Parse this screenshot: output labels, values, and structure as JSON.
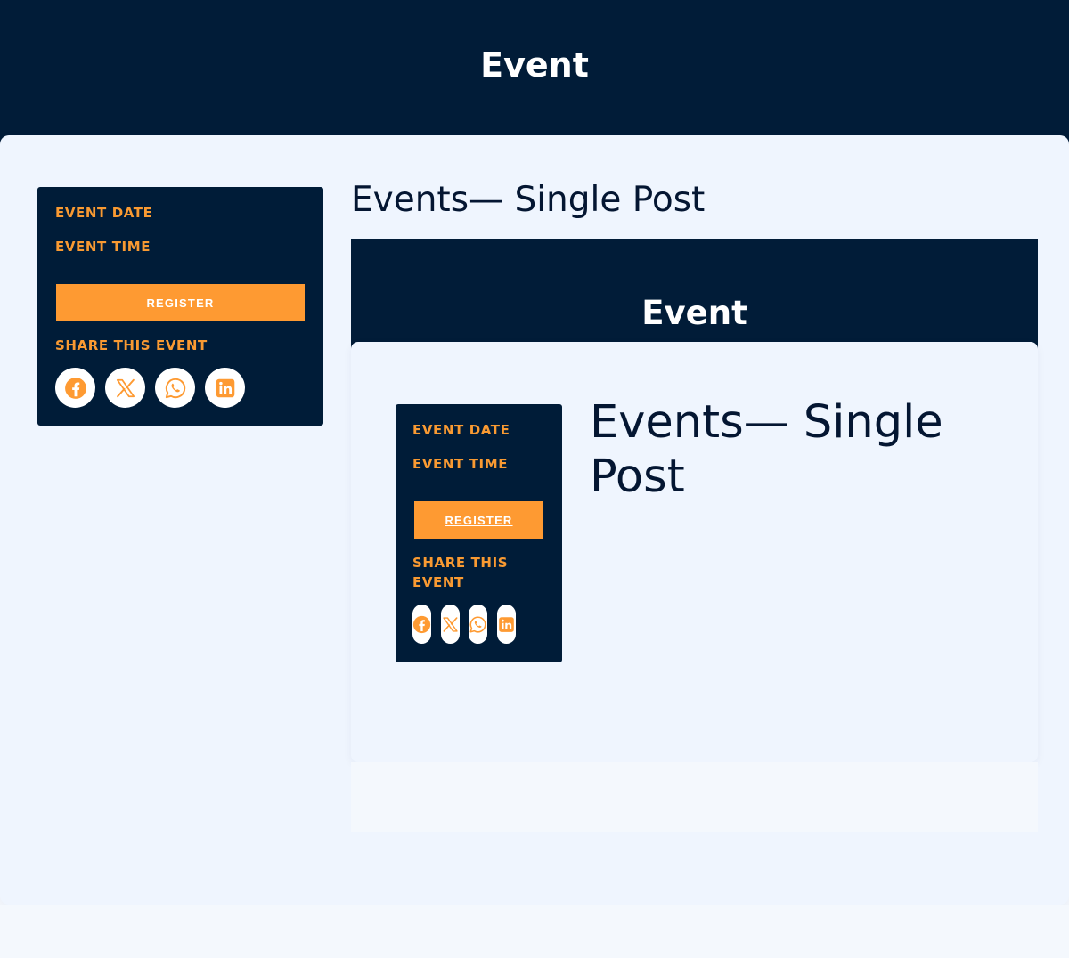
{
  "header": {
    "title": "Event"
  },
  "page": {
    "title": "Events— Single Post"
  },
  "sidebar": {
    "event_date_label": "EVENT DATE",
    "event_time_label": "EVENT TIME",
    "register_label": "REGISTER",
    "share_label": "SHARE THIS EVENT",
    "share_icons": [
      "facebook-icon",
      "x-icon",
      "whatsapp-icon",
      "linkedin-icon"
    ]
  },
  "embed": {
    "header_title": "Event",
    "page_title": "Events— Single Post",
    "sidebar": {
      "event_date_label": "EVENT DATE",
      "event_time_label": "EVENT TIME",
      "register_label": "REGISTER",
      "share_label": "SHARE THIS EVENT"
    }
  },
  "colors": {
    "navy": "#011c38",
    "accent": "#fe9a32",
    "label_orange": "#f99a32",
    "page_bg": "#f4f8fd",
    "card_bg": "#eff5fe",
    "title_text": "#041632"
  }
}
